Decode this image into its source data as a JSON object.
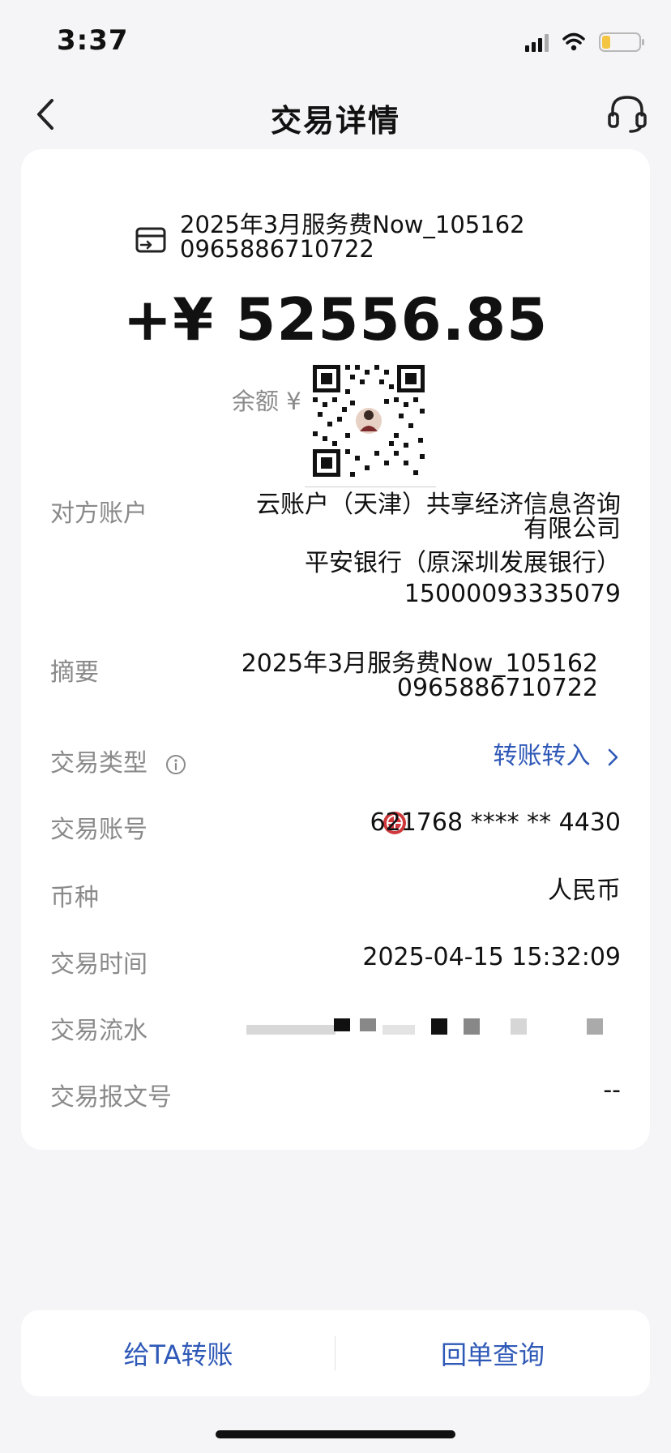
{
  "status": {
    "time": "3:37"
  },
  "nav": {
    "title": "交易详情"
  },
  "summary": {
    "line1": "2025年3月服务费Now_105162",
    "line2": "0965886710722"
  },
  "amount": {
    "text": "+¥ 52556.85"
  },
  "balance": {
    "label": "余额 ¥"
  },
  "rows": {
    "counterparty": {
      "label": "对方账户",
      "name_line1": "云账户（天津）共享经济信息咨询",
      "name_line2": "有限公司",
      "bank": "平安银行（原深圳发展银行）",
      "account": "15000093335079"
    },
    "memo": {
      "label": "摘要",
      "line1": "2025年3月服务费Now_105162",
      "line2": "0965886710722"
    },
    "type": {
      "label": "交易类型",
      "value": "转账转入"
    },
    "account": {
      "label": "交易账号",
      "value": "621768 **** ** 4430"
    },
    "currency": {
      "label": "币种",
      "value": "人民币"
    },
    "time": {
      "label": "交易时间",
      "value": "2025-04-15 15:32:09"
    },
    "flow": {
      "label": "交易流水"
    },
    "message": {
      "label": "交易报文号",
      "value": "--"
    }
  },
  "bottom": {
    "left": "给TA转账",
    "right": "回单查询"
  },
  "colors": {
    "accent": "#2f59b7",
    "label": "#8a8a8a",
    "background": "#f5f5f7"
  }
}
